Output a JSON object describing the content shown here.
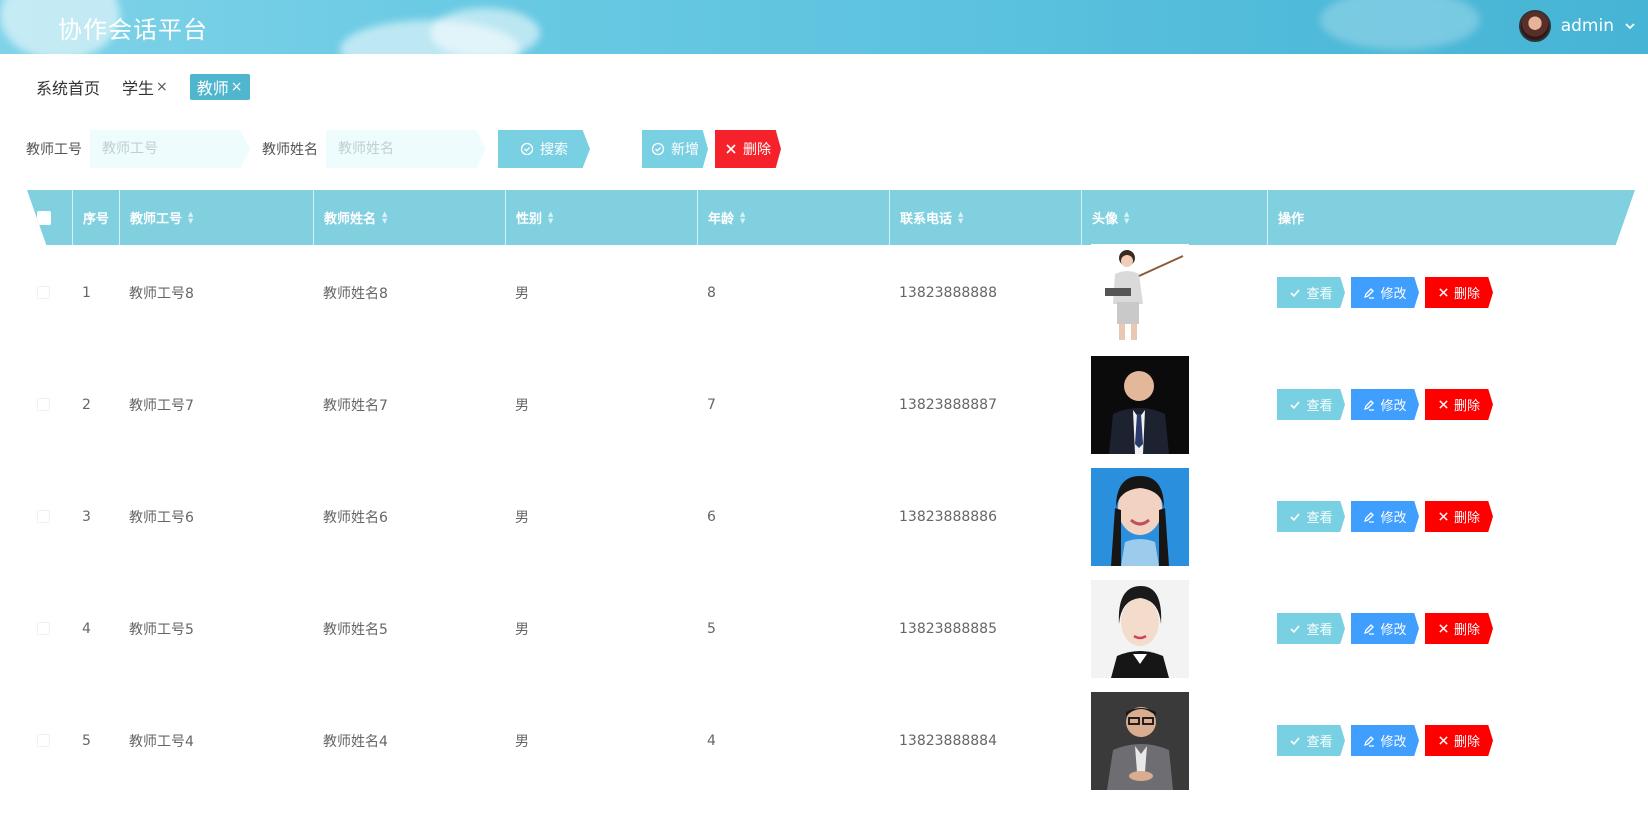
{
  "app": {
    "title": "协作会话平台"
  },
  "user": {
    "name": "admin",
    "avatar_icon": "user-avatar",
    "menu_icon": "chevron-down-icon"
  },
  "tabs": [
    {
      "label": "系统首页",
      "closable": false
    },
    {
      "label": "学生",
      "closable": true,
      "close": "×"
    },
    {
      "label": "教师",
      "closable": true,
      "close": "×",
      "active": true
    }
  ],
  "search": {
    "teacher_id_label": "教师工号",
    "teacher_id_placeholder": "教师工号",
    "teacher_name_label": "教师姓名",
    "teacher_name_placeholder": "教师姓名",
    "search_button": "搜索",
    "add_button": "新增",
    "delete_button": "删除"
  },
  "table": {
    "columns": [
      "序号",
      "教师工号",
      "教师姓名",
      "性别",
      "年龄",
      "联系电话",
      "头像",
      "操作"
    ],
    "rows": [
      {
        "index": "1",
        "teacher_id": "教师工号8",
        "teacher_name": "教师姓名8",
        "gender": "男",
        "age": "8",
        "phone": "13823888888",
        "avatar": "teacher-presenting-photo"
      },
      {
        "index": "2",
        "teacher_id": "教师工号7",
        "teacher_name": "教师姓名7",
        "gender": "男",
        "age": "7",
        "phone": "13823888887",
        "avatar": "man-in-suit-photo"
      },
      {
        "index": "3",
        "teacher_id": "教师工号6",
        "teacher_name": "教师姓名6",
        "gender": "男",
        "age": "6",
        "phone": "13823888886",
        "avatar": "woman-braids-photo"
      },
      {
        "index": "4",
        "teacher_id": "教师工号5",
        "teacher_name": "教师姓名5",
        "gender": "男",
        "age": "5",
        "phone": "13823888885",
        "avatar": "woman-portrait-photo"
      },
      {
        "index": "5",
        "teacher_id": "教师工号4",
        "teacher_name": "教师姓名4",
        "gender": "男",
        "age": "4",
        "phone": "13823888884",
        "avatar": "man-glasses-photo"
      }
    ],
    "actions": {
      "view": "查看",
      "edit": "修改",
      "delete": "删除"
    }
  },
  "colors": {
    "header": "#5ec3df",
    "teal": "#7ad0e3",
    "blue": "#409eff",
    "red": "#ff0000",
    "table_header": "#80d0e0"
  }
}
